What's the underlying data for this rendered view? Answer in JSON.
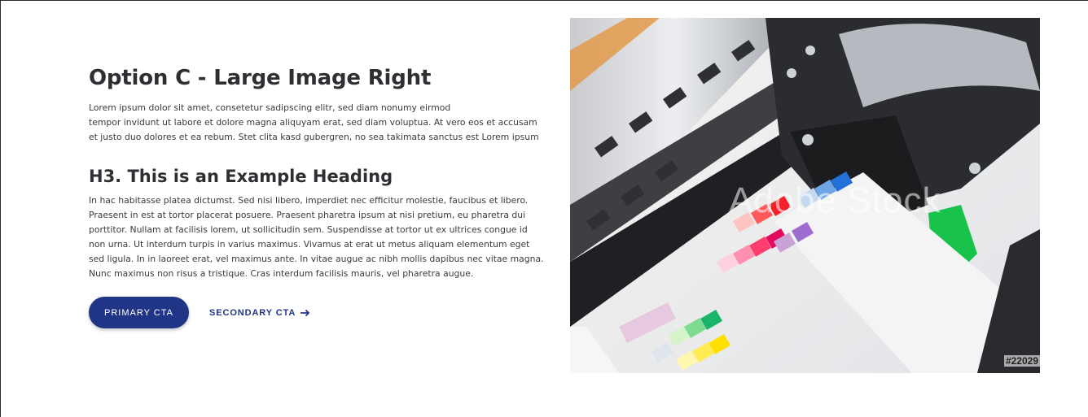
{
  "section": {
    "title": "Option C - Large Image Right",
    "lead_lines": [
      "Lorem ipsum dolor sit amet, consetetur sadipscing elitr, sed diam nonumy eirmod",
      "tempor invidunt ut labore et dolore magna aliquyam erat, sed diam voluptua. At vero eos et accusam",
      "et justo duo dolores et ea rebum. Stet clita kasd gubergren, no sea takimata sanctus est Lorem ipsum"
    ],
    "subheading": "H3. This is an Example Heading",
    "body_lines": [
      "In hac habitasse platea dictumst. Sed nisi libero, imperdiet nec efficitur molestie, faucibus et libero.",
      "Praesent in est at tortor placerat posuere. Praesent pharetra ipsum at nisi pretium, eu pharetra dui",
      "porttitor. Nullam at facilisis lorem, ut sollicitudin sem. Suspendisse at tortor ut ex ultrices congue id",
      "non urna. Ut interdum turpis in varius maximus. Vivamus at erat ut metus aliquam elementum eget",
      "sed ligula. In in laoreet erat, vel maximus ante. In vitae augue ac nibh mollis dapibus nec vitae magna.",
      "Nunc maximus non risus a tristique. Cras interdum facilisis mauris, vel pharetra augue."
    ]
  },
  "ctas": {
    "primary_label": "PRIMARY CTA",
    "secondary_label": "SECONDARY CTA"
  },
  "image": {
    "watermark": "Adobe Stock",
    "stock_id": "#22029"
  },
  "colors": {
    "brand_navy": "#213586",
    "text_dark": "#2e2e33"
  }
}
